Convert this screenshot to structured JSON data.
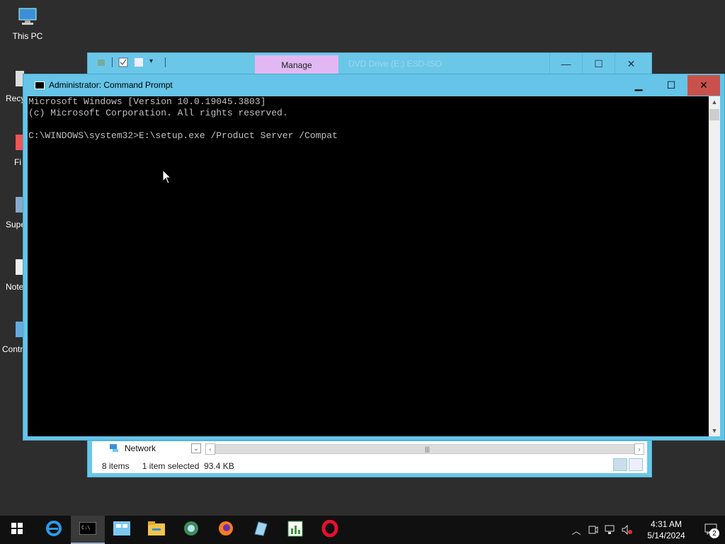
{
  "desktop": {
    "icons": [
      {
        "label": "This PC"
      },
      {
        "label": "Recy"
      },
      {
        "label": "Fi"
      },
      {
        "label": "Supe"
      },
      {
        "label": "Note"
      },
      {
        "label": "Contr"
      }
    ]
  },
  "explorer": {
    "manage_tab": "Manage",
    "title": "DVD Drive (E:) ESD-ISO",
    "nav_item": "Network",
    "status": {
      "items_count": "8 items",
      "selection": "1 item selected",
      "size": "93.4 KB"
    }
  },
  "cmd": {
    "title": "Administrator: Command Prompt",
    "lines": [
      "Microsoft Windows [Version 10.0.19045.3803]",
      "(c) Microsoft Corporation. All rights reserved.",
      "",
      "C:\\WINDOWS\\system32>E:\\setup.exe /Product Server /Compat"
    ]
  },
  "taskbar": {
    "clock_time": "4:31 AM",
    "clock_date": "5/14/2024",
    "notification_count": "2"
  }
}
